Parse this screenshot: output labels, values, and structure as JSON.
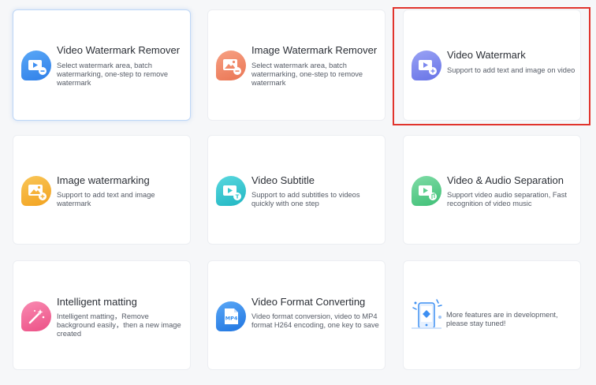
{
  "cards": [
    {
      "title": "Video Watermark Remover",
      "desc": "Select watermark area, batch watermarking, one-step to remove watermark",
      "icon": "video-remove-icon",
      "color": "#3d8ff2"
    },
    {
      "title": "Image Watermark Remover",
      "desc": "Select watermark area, batch watermarking, one-step to remove watermark",
      "icon": "image-remove-icon",
      "color": "#f08a6a"
    },
    {
      "title": "Video Watermark",
      "desc": "Support to add text and image on video",
      "icon": "video-add-icon",
      "color": "#7b87ee"
    },
    {
      "title": "Image watermarking",
      "desc": "Support to add text and image watermark",
      "icon": "image-add-icon",
      "color": "#f6b23a"
    },
    {
      "title": "Video Subtitle",
      "desc": "Support to add subtitles to videos quickly with one step",
      "icon": "video-subtitle-icon",
      "color": "#35c7cf"
    },
    {
      "title": "Video & Audio Separation",
      "desc": "Support video audio separation, Fast recognition of video music",
      "icon": "audio-separation-icon",
      "color": "#5bcf8d"
    },
    {
      "title": "Intelligent matting",
      "desc": "Intelligent matting，Remove background easily，then a new image created",
      "icon": "magic-wand-icon",
      "color": "#f2699a"
    },
    {
      "title": "Video Format Converting",
      "desc": "Video format conversion, video to MP4 format H264 encoding, one key to save",
      "icon": "mp4-file-icon",
      "color": "#2f8cf0",
      "icon_label": "MP4"
    }
  ],
  "development": {
    "text": "More features are in development, please stay tuned!",
    "icon": "development-illustration-icon",
    "color": "#3d8ff2"
  },
  "highlight_color": "#e1342d"
}
